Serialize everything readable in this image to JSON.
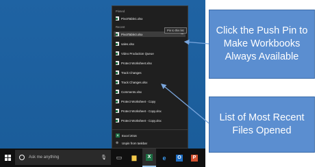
{
  "jumplist": {
    "pinned_title": "Pinned",
    "recent_title": "Recent",
    "pinned_items": [
      "PivotTable1.xlsx"
    ],
    "recent_items": [
      "PivotTable3.xlsx",
      "sales.xlsx",
      "Video Production Queue",
      "Protect Worksheet.xlsx",
      "Track Changes",
      "Track Changes.xlsx",
      "Comments.xlsx",
      "Protect Worksheet - Copy",
      "Protect Worksheet - Copy.xlsx",
      "Protect Worksheet - Copy.xlsx"
    ],
    "tooltip": "Pin to this list",
    "app_name": "Excel 2016",
    "unpin_label": "Unpin from taskbar"
  },
  "taskbar": {
    "search_placeholder": "Ask me anything",
    "icons": [
      "task-view-icon",
      "file-explorer-icon",
      "excel-icon",
      "edge-icon",
      "outlook-icon",
      "powerpoint-icon"
    ]
  },
  "callouts": {
    "pin": "Click the Push Pin to Make Workbooks Always Available",
    "recent": "List of Most Recent Files Opened"
  },
  "colors": {
    "desktop": "#1f63a3",
    "callout_fill": "#5b8ed0",
    "excel_green": "#1d7044"
  }
}
